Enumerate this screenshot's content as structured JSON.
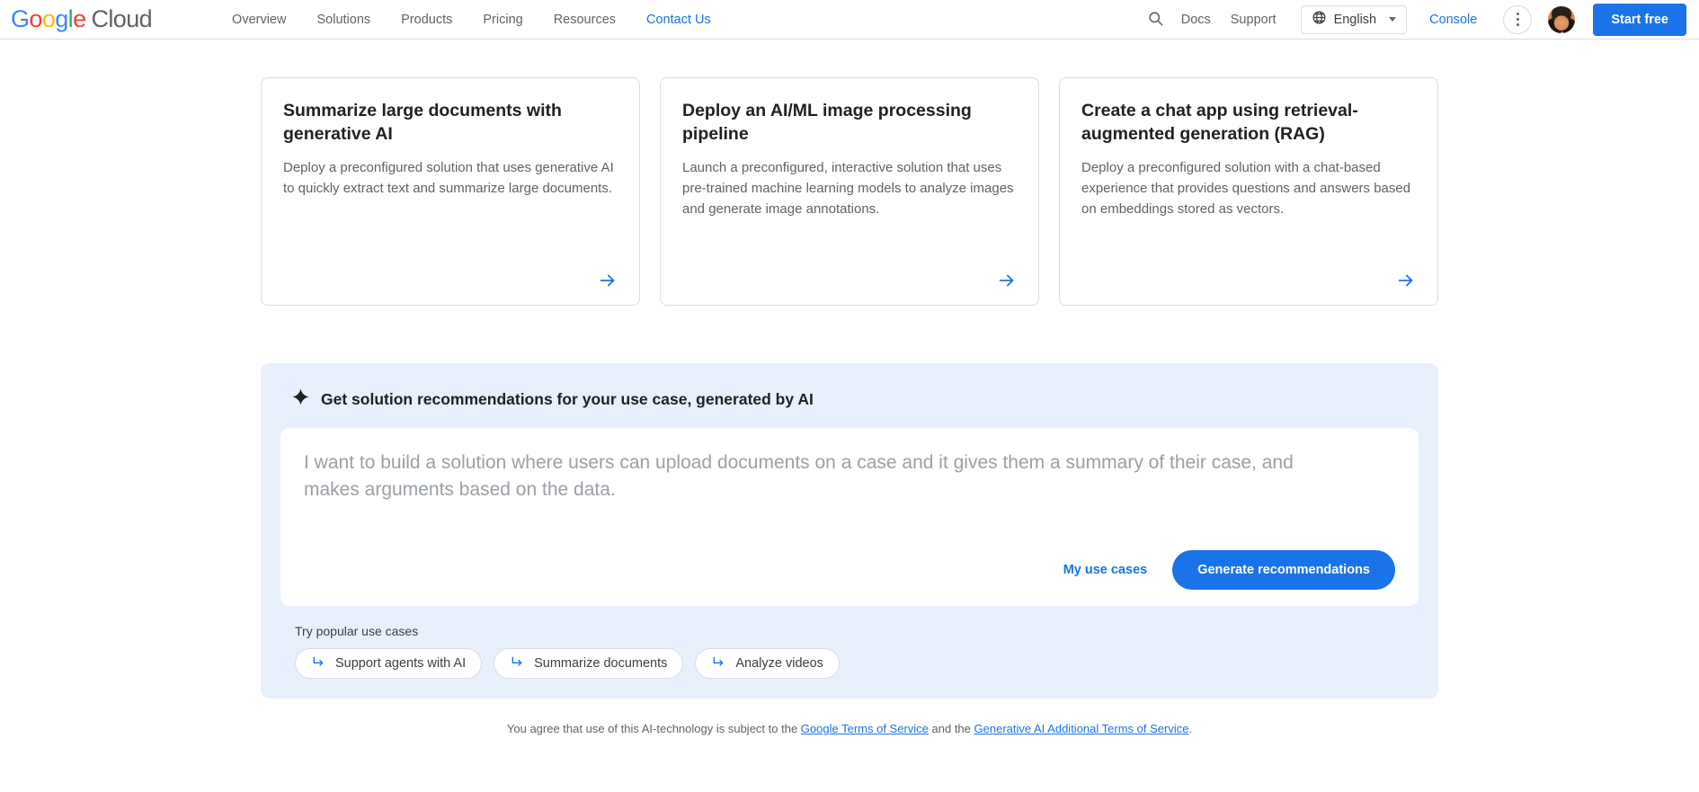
{
  "header": {
    "logo": {
      "google": "Google",
      "cloud": "Cloud"
    },
    "nav": [
      {
        "label": "Overview",
        "active": false
      },
      {
        "label": "Solutions",
        "active": false
      },
      {
        "label": "Products",
        "active": false
      },
      {
        "label": "Pricing",
        "active": false
      },
      {
        "label": "Resources",
        "active": false
      },
      {
        "label": "Contact Us",
        "active": true
      }
    ],
    "search_icon": "search-icon",
    "docs": "Docs",
    "support": "Support",
    "language": {
      "icon": "globe-icon",
      "label": "English",
      "caret": "chevron-down-icon"
    },
    "console": "Console",
    "more_menu": "more-vert-icon",
    "avatar": "user-avatar",
    "start_free": "Start free",
    "accent_blue": "#1a73e8"
  },
  "cards": [
    {
      "title": "Summarize large documents with generative AI",
      "description": "Deploy a preconfigured solution that uses generative AI to quickly extract text and summarize large documents.",
      "arrow": "arrow-right-icon"
    },
    {
      "title": "Deploy an AI/ML image processing pipeline",
      "description": "Launch a preconfigured, interactive solution that uses pre-trained machine learning models to analyze images and generate image annotations.",
      "arrow": "arrow-right-icon"
    },
    {
      "title": "Create a chat app using retrieval-augmented generation (RAG)",
      "description": "Deploy a preconfigured solution with a chat-based experience that provides questions and answers based on embeddings stored as vectors.",
      "arrow": "arrow-right-icon"
    }
  ],
  "ai_panel": {
    "sparkle_icon": "sparkle-icon",
    "heading": "Get solution recommendations for your use case, generated by AI",
    "input": {
      "value": "",
      "placeholder": "I want to build a solution where users can upload documents on a case and it gives them a summary of their case, and makes arguments based on the data."
    },
    "my_use_cases": "My use cases",
    "generate_button": "Generate recommendations",
    "chips_label": "Try popular use cases",
    "chips": [
      {
        "label": "Support agents with AI",
        "icon": "subdirectory-arrow-right-icon"
      },
      {
        "label": "Summarize documents",
        "icon": "subdirectory-arrow-right-icon"
      },
      {
        "label": "Analyze videos",
        "icon": "subdirectory-arrow-right-icon"
      }
    ],
    "background": "#e8f0fe"
  },
  "disclaimer": {
    "prefix": "You agree that use of this AI-technology is subject to the ",
    "link1": "Google Terms of Service",
    "middle": " and the ",
    "link2": "Generative AI Additional Terms of Service",
    "suffix": "."
  }
}
